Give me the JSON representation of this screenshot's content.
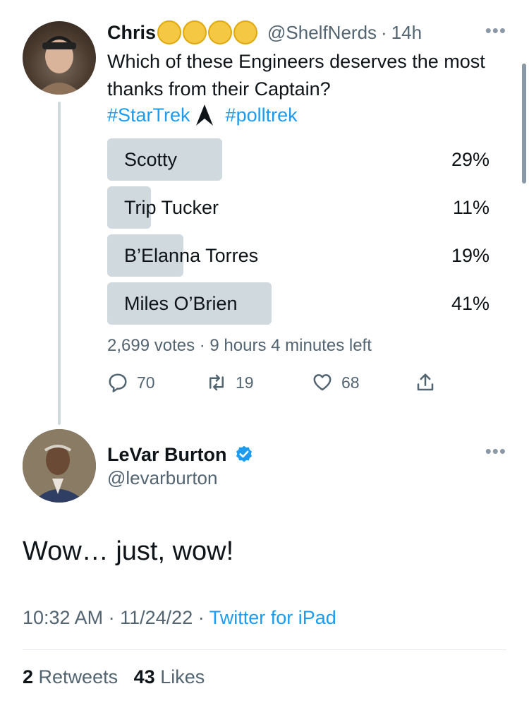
{
  "tweet1": {
    "name": "Chris",
    "emoji_count": 4,
    "handle": "@ShelfNerds",
    "separator": "·",
    "time": "14h",
    "text": "Which of these Engineers deserves the most thanks from their Captain?",
    "hashtags": [
      "#StarTrek",
      "#polltrek"
    ],
    "poll": {
      "options": [
        {
          "label": "Scotty",
          "percent_text": "29%",
          "percent": 29,
          "bar_fraction": 0.3
        },
        {
          "label": "Trip Tucker",
          "percent_text": "11%",
          "percent": 11,
          "bar_fraction": 0.115
        },
        {
          "label": "B’Elanna Torres",
          "percent_text": "19%",
          "percent": 19,
          "bar_fraction": 0.2
        },
        {
          "label": "Miles O’Brien",
          "percent_text": "41%",
          "percent": 41,
          "bar_fraction": 0.43
        }
      ],
      "footer": "2,699 votes · 9 hours 4 minutes left"
    },
    "actions": {
      "replies": "70",
      "retweets": "19",
      "likes": "68"
    }
  },
  "tweet2": {
    "name": "LeVar Burton",
    "handle": "@levarburton",
    "text": "Wow… just, wow!",
    "time": "10:32 AM",
    "date": "11/24/22",
    "separator": "·",
    "source": "Twitter for iPad",
    "retweets_count": "2",
    "retweets_label": "Retweets",
    "likes_count": "43",
    "likes_label": "Likes"
  },
  "colors": {
    "link": "#1d9bf0",
    "secondary_text": "#536471",
    "poll_bar": "#cfd9de",
    "emoji_coin": "#f4c842"
  },
  "icons": [
    "more-icon",
    "reply-icon",
    "retweet-icon",
    "like-icon",
    "share-icon",
    "verified-icon",
    "starfleet-delta-icon"
  ]
}
